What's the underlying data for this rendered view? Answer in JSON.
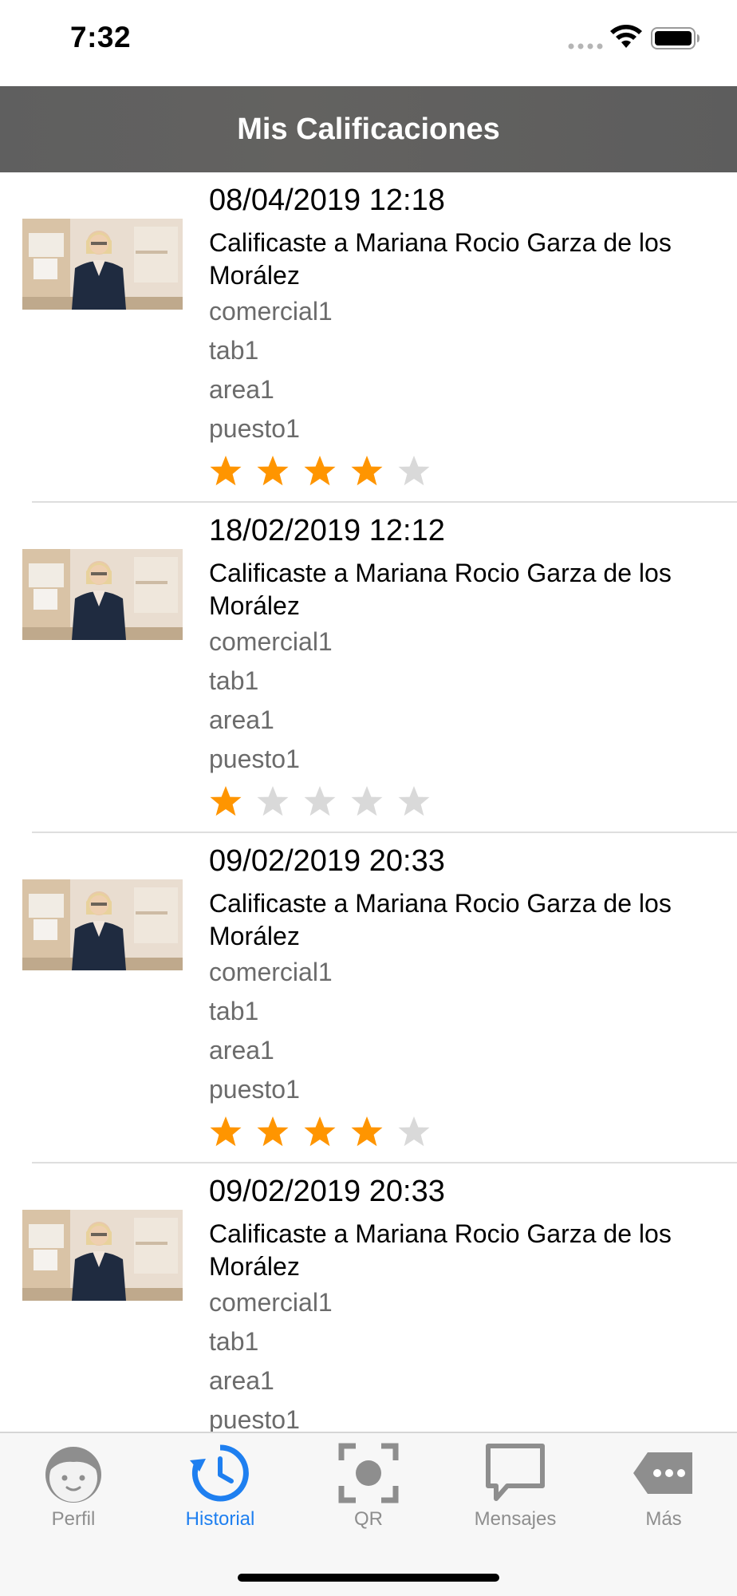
{
  "status_bar": {
    "time": "7:32"
  },
  "header": {
    "title": "Mis Calificaciones"
  },
  "ratings": [
    {
      "date": "08/04/2019 12:18",
      "description": "Calificaste a Mariana Rocio Garza de los Morález",
      "commercial": "comercial1",
      "tab": "tab1",
      "area": "area1",
      "position": "puesto1",
      "stars": 4
    },
    {
      "date": "18/02/2019 12:12",
      "description": "Calificaste a Mariana Rocio Garza de los Morález",
      "commercial": "comercial1",
      "tab": "tab1",
      "area": "area1",
      "position": "puesto1",
      "stars": 1
    },
    {
      "date": "09/02/2019 20:33",
      "description": "Calificaste a Mariana Rocio Garza de los Morález",
      "commercial": "comercial1",
      "tab": "tab1",
      "area": "area1",
      "position": "puesto1",
      "stars": 4
    },
    {
      "date": "09/02/2019 20:33",
      "description": "Calificaste a Mariana Rocio Garza de los Morález",
      "commercial": "comercial1",
      "tab": "tab1",
      "area": "area1",
      "position": "puesto1",
      "stars": null
    }
  ],
  "rating_max": 5,
  "tab_bar": {
    "tabs": [
      {
        "label": "Perfil",
        "icon": "face-icon",
        "active": false
      },
      {
        "label": "Historial",
        "icon": "history-icon",
        "active": true
      },
      {
        "label": "QR",
        "icon": "qr-scan-icon",
        "active": false
      },
      {
        "label": "Mensajes",
        "icon": "message-icon",
        "active": false
      },
      {
        "label": "Más",
        "icon": "more-icon",
        "active": false
      }
    ]
  },
  "colors": {
    "accent": "#1e7ff0",
    "star_filled": "#ff9500",
    "star_empty": "#d9d9d9",
    "header_bg": "#5f5f5f",
    "inactive_tab": "#8e8e8e"
  }
}
